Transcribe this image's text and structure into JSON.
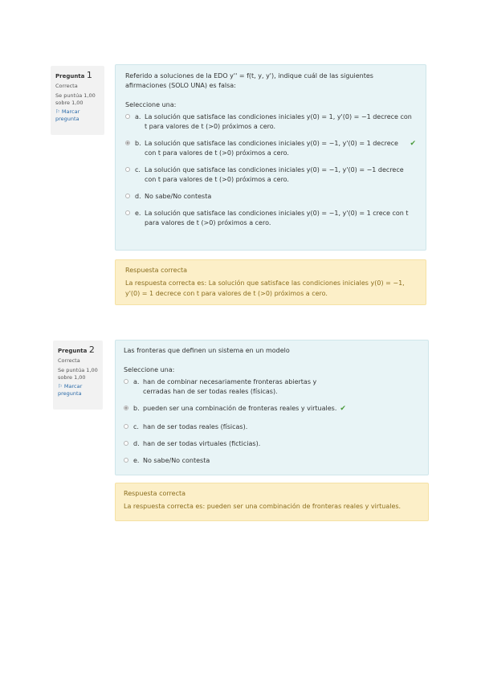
{
  "q1": {
    "info": {
      "label": "Pregunta",
      "number": "1",
      "state": "Correcta",
      "grade": "Se puntúa 1,00 sobre 1,00",
      "flag": "Marcar pregunta"
    },
    "prompt": "Referido a soluciones de la EDO y'' = f(t, y, y'), indique cuál de las siguientes afirmaciones (SOLO UNA) es falsa:",
    "select_label": "Seleccione una:",
    "options": [
      {
        "letter": "a.",
        "text": "La solución que satisface las condiciones iniciales y(0) = 1, y'(0) = −1 decrece con t para valores de t (>0) próximos a cero."
      },
      {
        "letter": "b.",
        "text": "La solución que satisface las condiciones iniciales y(0) = −1, y'(0) = 1 decrece con t para valores de t (>0) próximos a cero.",
        "correct_mark": "✔"
      },
      {
        "letter": "c.",
        "text": "La solución que satisface las condiciones iniciales y(0) = −1, y'(0) = −1 decrece con t para valores de t (>0) próximos a cero."
      },
      {
        "letter": "d.",
        "text": "No sabe/No contesta"
      },
      {
        "letter": "e.",
        "text": "La solución que satisface las condiciones iniciales y(0) = −1, y'(0) = 1 crece con t para valores de t (>0) próximos a cero."
      }
    ],
    "selected_index": 1,
    "feedback": {
      "title": "Respuesta correcta",
      "text": "La respuesta correcta es: La solución que satisface las condiciones iniciales y(0) = −1, y'(0) = 1 decrece con t para valores de t (>0) próximos a cero."
    }
  },
  "q2": {
    "info": {
      "label": "Pregunta",
      "number": "2",
      "state": "Correcta",
      "grade": "Se puntúa 1,00 sobre 1,00",
      "flag": "Marcar pregunta"
    },
    "prompt": "Las fronteras que definen un sistema en un modelo",
    "select_label": "Seleccione una:",
    "options": [
      {
        "letter": "a.",
        "text": "han de combinar necesariamente fronteras abiertas y cerradas han de ser todas reales (físicas)."
      },
      {
        "letter": "b.",
        "text": "pueden ser una combinación de fronteras reales y virtuales.",
        "correct_mark": "✔"
      },
      {
        "letter": "c.",
        "text": "han de ser todas reales (físicas)."
      },
      {
        "letter": "d.",
        "text": "han de ser todas virtuales (ficticias)."
      },
      {
        "letter": "e.",
        "text": "No sabe/No contesta"
      }
    ],
    "selected_index": 1,
    "feedback": {
      "title": "Respuesta correcta",
      "text": "La respuesta correcta es: pueden ser una combinación de fronteras reales y virtuales."
    }
  }
}
